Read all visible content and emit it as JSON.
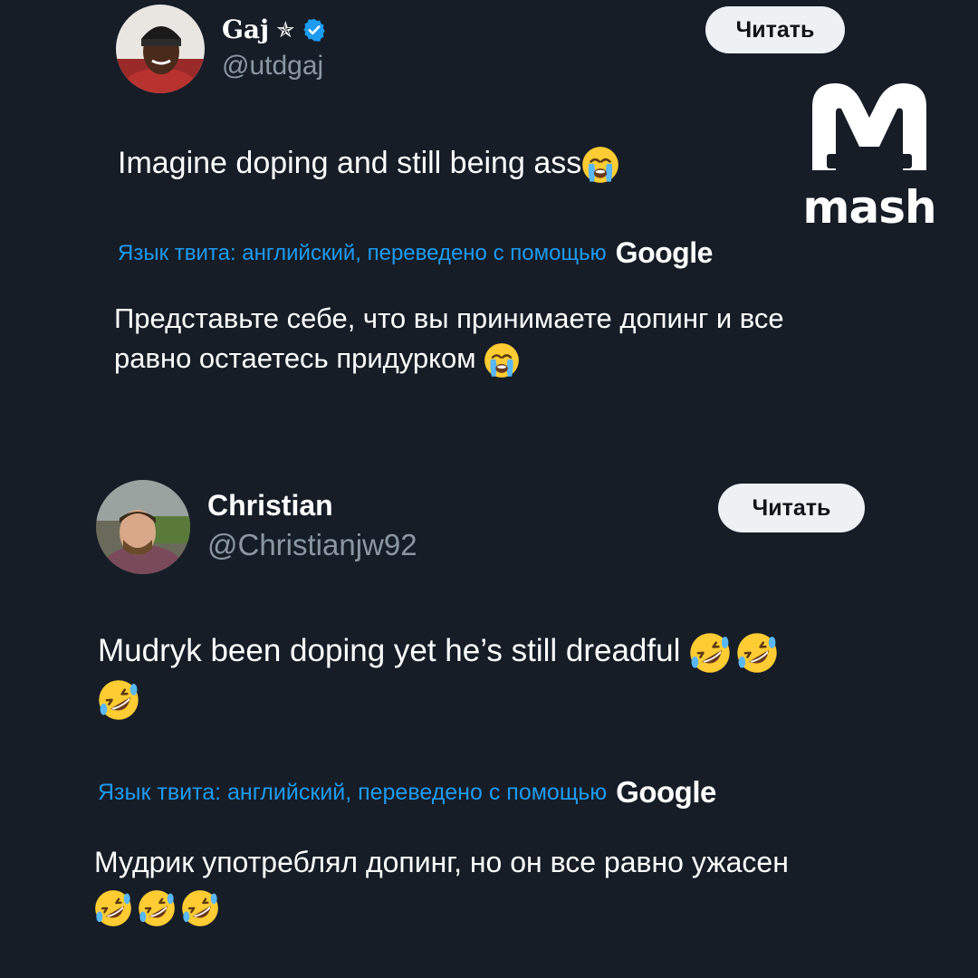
{
  "tweets": [
    {
      "name": "Gaj",
      "name_suffix": "✯",
      "handle": "@utdgaj",
      "follow_label": "Читать",
      "text": "Imagine doping and still being ass",
      "text_emoji": "loudly-crying-face",
      "translate_label": "Язык твита: английский, переведено с помощью",
      "translate_provider": "Google",
      "translation": "Представьте себе, что вы принимаете допинг и все равно остаетесь придурком",
      "translation_emoji": "loudly-crying-face"
    },
    {
      "name": "Christian",
      "handle": "@Christianjw92",
      "follow_label": "Читать",
      "text": "Mudryk been doping yet he’s still dreadful",
      "text_emoji": "rolling-on-floor-laughing-face",
      "translate_label": "Язык твита: английский, переведено с помощью",
      "translate_provider": "Google",
      "translation": "Мудрик употреблял допинг, но он все равно ужасен",
      "translation_emoji": "rolling-on-floor-laughing-face"
    }
  ],
  "watermark": {
    "brand": "mash"
  },
  "colors": {
    "background": "#161d27",
    "link_blue": "#1d9bf0",
    "verified_badge": "#1d9bf0",
    "handle_gray": "#8b97a3",
    "button_bg": "#eef1f4"
  }
}
